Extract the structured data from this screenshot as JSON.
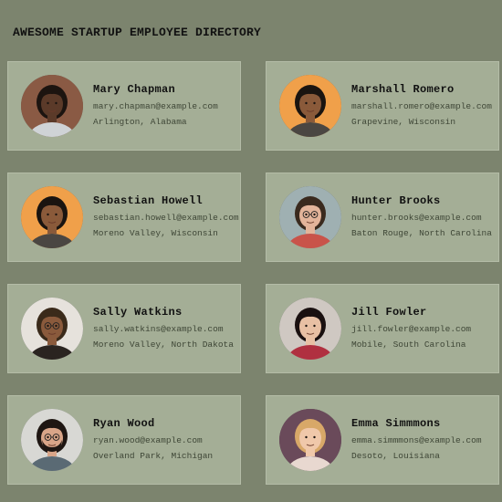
{
  "page": {
    "title": "AWESOME STARTUP EMPLOYEE DIRECTORY",
    "background": "#7c846e",
    "card_color": "#a4ae96"
  },
  "employees": [
    {
      "name": "Mary Chapman",
      "email": "mary.chapman@example.com",
      "location": "Arlington, Alabama",
      "avatar": "portrait-woman-curly-hair",
      "photo_bg": "#8a5a44",
      "skin": "#5b3a29",
      "hair": "#1c1410",
      "shirt": "#cfd3d6"
    },
    {
      "name": "Marshall Romero",
      "email": "marshall.romero@example.com",
      "location": "Grapevine, Wisconsin",
      "avatar": "portrait-man-orange-background",
      "photo_bg": "#f0a04a",
      "skin": "#8a5a3a",
      "hair": "#1a1410",
      "shirt": "#4a4642"
    },
    {
      "name": "Sebastian Howell",
      "email": "sebastian.howell@example.com",
      "location": "Moreno Valley, Wisconsin",
      "avatar": "portrait-man-orange-background",
      "photo_bg": "#f0a04a",
      "skin": "#8a5a3a",
      "hair": "#1a1410",
      "shirt": "#4a4642"
    },
    {
      "name": "Hunter Brooks",
      "email": "hunter.brooks@example.com",
      "location": "Baton Rouge, North Carolina",
      "avatar": "portrait-man-glasses",
      "photo_bg": "#9fb0b2",
      "skin": "#e3b49a",
      "hair": "#3a2a1e",
      "shirt": "#c9534a"
    },
    {
      "name": "Sally Watkins",
      "email": "sally.watkins@example.com",
      "location": "Moreno Valley, North Dakota",
      "avatar": "portrait-woman-glasses",
      "photo_bg": "#e6e2dc",
      "skin": "#8a5a3c",
      "hair": "#3a2a1a",
      "shirt": "#2a2420"
    },
    {
      "name": "Jill Fowler",
      "email": "jill.fowler@example.com",
      "location": "Mobile, South Carolina",
      "avatar": "portrait-woman-dark-hair",
      "photo_bg": "#cfc8c2",
      "skin": "#e8c0a4",
      "hair": "#1a1010",
      "shirt": "#b03040"
    },
    {
      "name": "Ryan Wood",
      "email": "ryan.wood@example.com",
      "location": "Overland Park, Michigan",
      "avatar": "portrait-man-beard-glasses",
      "photo_bg": "#d8d8d4",
      "skin": "#d9a588",
      "hair": "#1e1612",
      "shirt": "#5a6a74"
    },
    {
      "name": "Emma Simmmons",
      "email": "emma.simmmons@example.com",
      "location": "Desoto, Louisiana",
      "avatar": "portrait-woman-blonde",
      "photo_bg": "#6a4a5a",
      "skin": "#f0c8aa",
      "hair": "#d8a868",
      "shirt": "#e8d8d0"
    }
  ]
}
